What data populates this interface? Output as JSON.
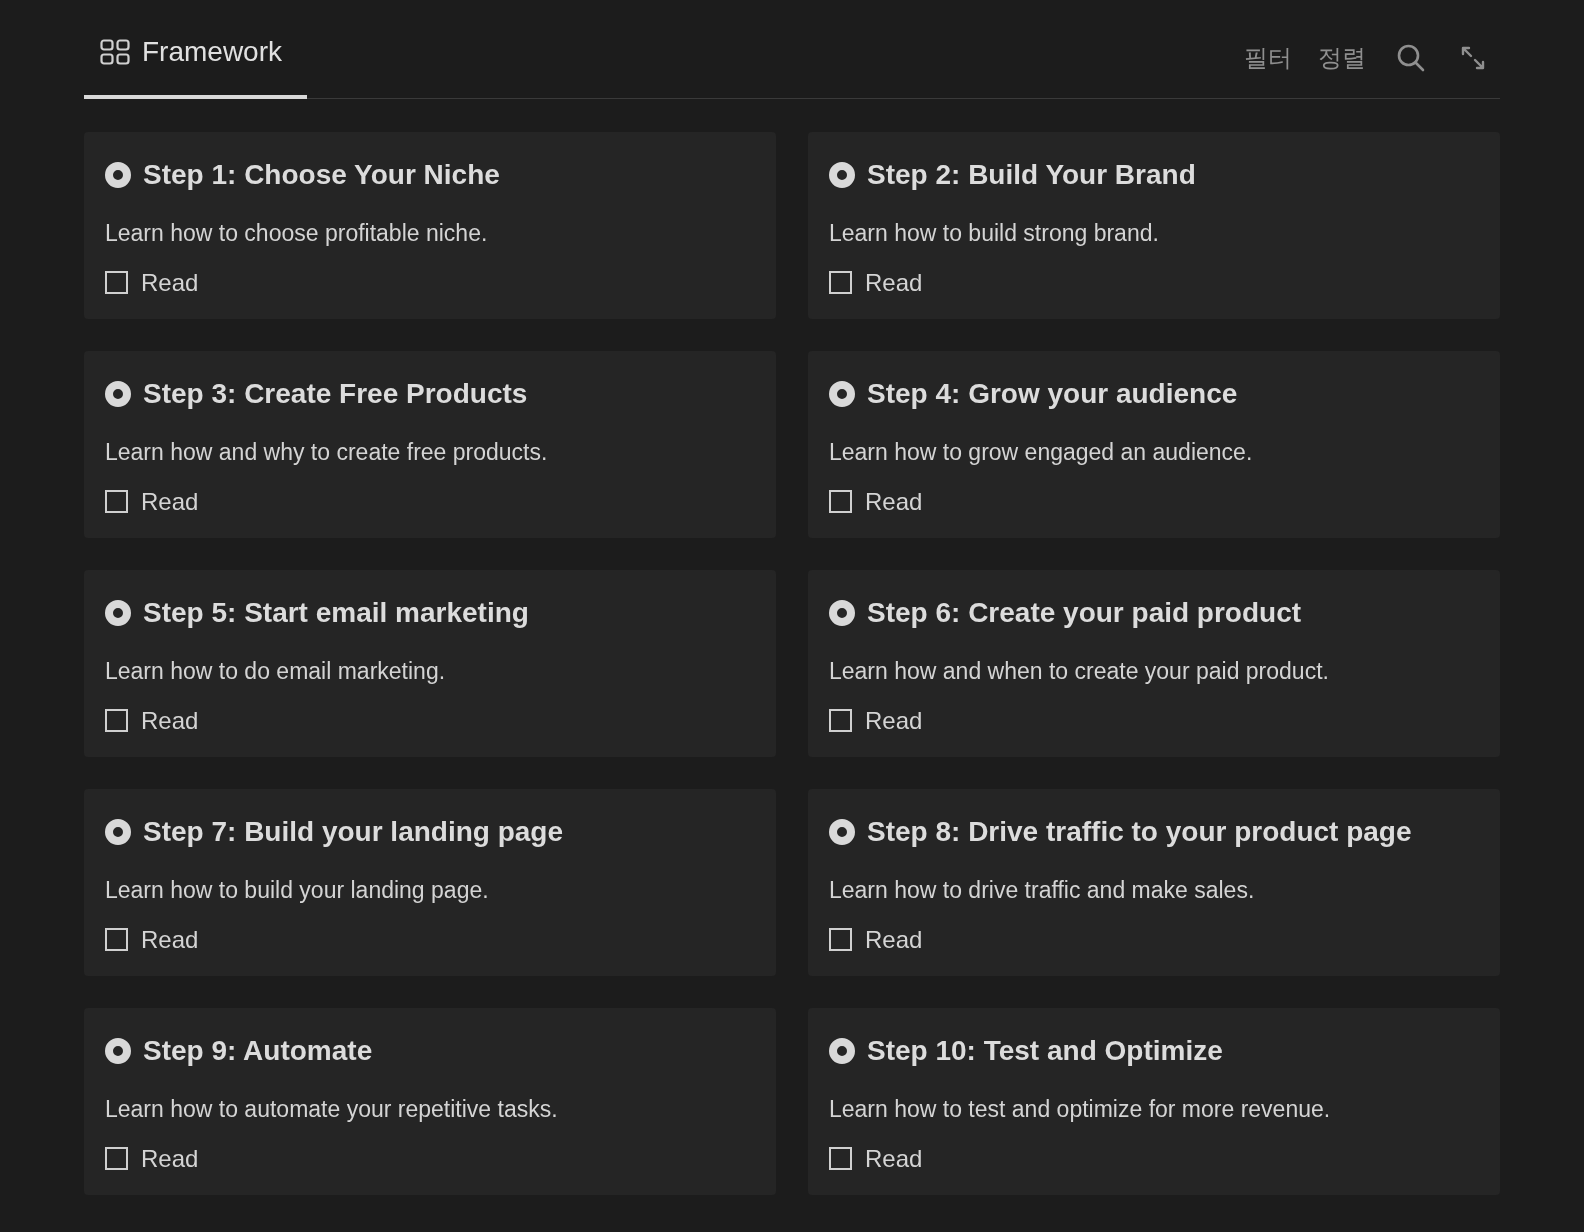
{
  "tabs": [
    {
      "label": "Framework",
      "selected": true
    }
  ],
  "toolbar": {
    "filter": "필터",
    "sort": "정렬"
  },
  "cards": [
    {
      "title": "Step 1: Choose Your Niche",
      "description": "Learn how to choose profitable niche.",
      "checkbox": {
        "label": "Read",
        "checked": false
      }
    },
    {
      "title": "Step 2: Build Your Brand",
      "description": "Learn how to build strong brand.",
      "checkbox": {
        "label": "Read",
        "checked": false
      }
    },
    {
      "title": "Step 3: Create Free Products",
      "description": "Learn how and why to create free products.",
      "checkbox": {
        "label": "Read",
        "checked": false
      }
    },
    {
      "title": "Step 4: Grow your audience",
      "description": "Learn how to grow engaged an audience.",
      "checkbox": {
        "label": "Read",
        "checked": false
      }
    },
    {
      "title": "Step 5: Start email marketing",
      "description": "Learn how to do email marketing.",
      "checkbox": {
        "label": "Read",
        "checked": false
      }
    },
    {
      "title": "Step 6: Create your paid product",
      "description": "Learn how and when to create your paid product.",
      "checkbox": {
        "label": "Read",
        "checked": false
      }
    },
    {
      "title": "Step 7: Build your landing page",
      "description": "Learn how to build your landing page.",
      "checkbox": {
        "label": "Read",
        "checked": false
      }
    },
    {
      "title": "Step 8: Drive traffic to your product page",
      "description": "Learn how to drive traffic and make sales.",
      "checkbox": {
        "label": "Read",
        "checked": false
      }
    },
    {
      "title": "Step 9: Automate",
      "description": "Learn how to automate your repetitive tasks.",
      "checkbox": {
        "label": "Read",
        "checked": false
      }
    },
    {
      "title": "Step 10: Test and Optimize",
      "description": "Learn how to test and optimize for more revenue.",
      "checkbox": {
        "label": "Read",
        "checked": false
      }
    }
  ]
}
